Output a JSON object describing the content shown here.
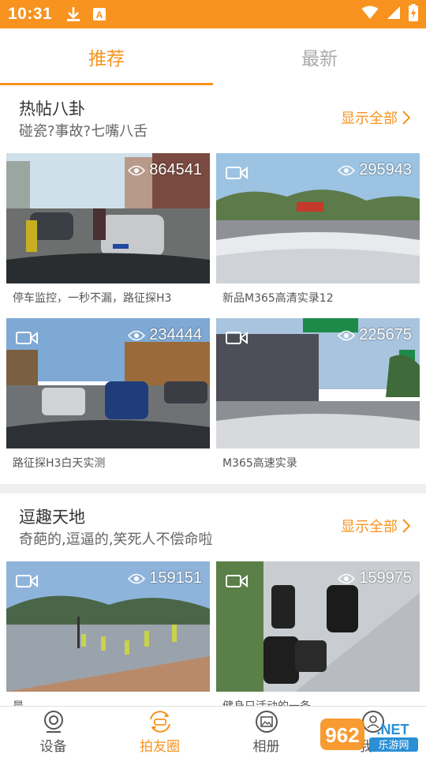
{
  "status_bar": {
    "time": "10:31"
  },
  "tabs": [
    {
      "label": "推荐",
      "active": true
    },
    {
      "label": "最新",
      "active": false
    }
  ],
  "sections": [
    {
      "title": "热帖八卦",
      "subtitle": "碰瓷?事故?七嘴八舌",
      "show_all": "显示全部",
      "videos": [
        {
          "views": "864541",
          "caption": "停车监控，一秒不漏，路征探H3",
          "has_cam_icon": false
        },
        {
          "views": "295943",
          "caption": "新品M365高清实录12",
          "has_cam_icon": true
        },
        {
          "views": "234444",
          "caption": "路征探H3白天实测",
          "has_cam_icon": true
        },
        {
          "views": "225675",
          "caption": "M365高速实录",
          "has_cam_icon": true
        }
      ]
    },
    {
      "title": "逗趣天地",
      "subtitle": "奇葩的,逗逼的,笑死人不偿命啦",
      "show_all": "显示全部",
      "videos": [
        {
          "views": "159151",
          "caption": "晨",
          "has_cam_icon": true
        },
        {
          "views": "159975",
          "caption": "健身只活动的一条",
          "has_cam_icon": true
        }
      ]
    }
  ],
  "bottom_nav": [
    {
      "label": "设备",
      "icon": "device-camera-icon",
      "active": false
    },
    {
      "label": "拍友圈",
      "icon": "community-car-icon",
      "active": true
    },
    {
      "label": "相册",
      "icon": "album-icon",
      "active": false
    },
    {
      "label": "我的",
      "icon": "profile-icon",
      "active": false
    }
  ],
  "watermark": {
    "text1": "962",
    "text2": ".NET",
    "text3": "乐游网"
  },
  "colors": {
    "accent": "#f7931e",
    "divider": "#efefef"
  }
}
